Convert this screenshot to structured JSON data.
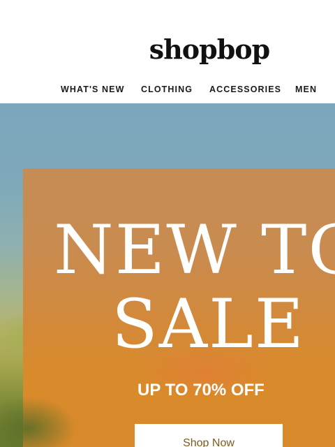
{
  "header": {
    "logo": "shopbop"
  },
  "nav": {
    "items": [
      {
        "label": "WHAT'S NEW"
      },
      {
        "label": "CLOTHING"
      },
      {
        "label": "ACCESSORIES"
      },
      {
        "label": "MEN"
      }
    ]
  },
  "hero": {
    "headline_line1": "NEW TO",
    "headline_line2": "SALE",
    "subhead": "UP TO 70% OFF",
    "cta_label": "Shop Now",
    "colors": {
      "sky": "#7aa7bd",
      "field": "#7e8b38",
      "promo_panel": "#d3893a",
      "text": "#ffffff",
      "cta_text": "#7a5a20"
    }
  }
}
